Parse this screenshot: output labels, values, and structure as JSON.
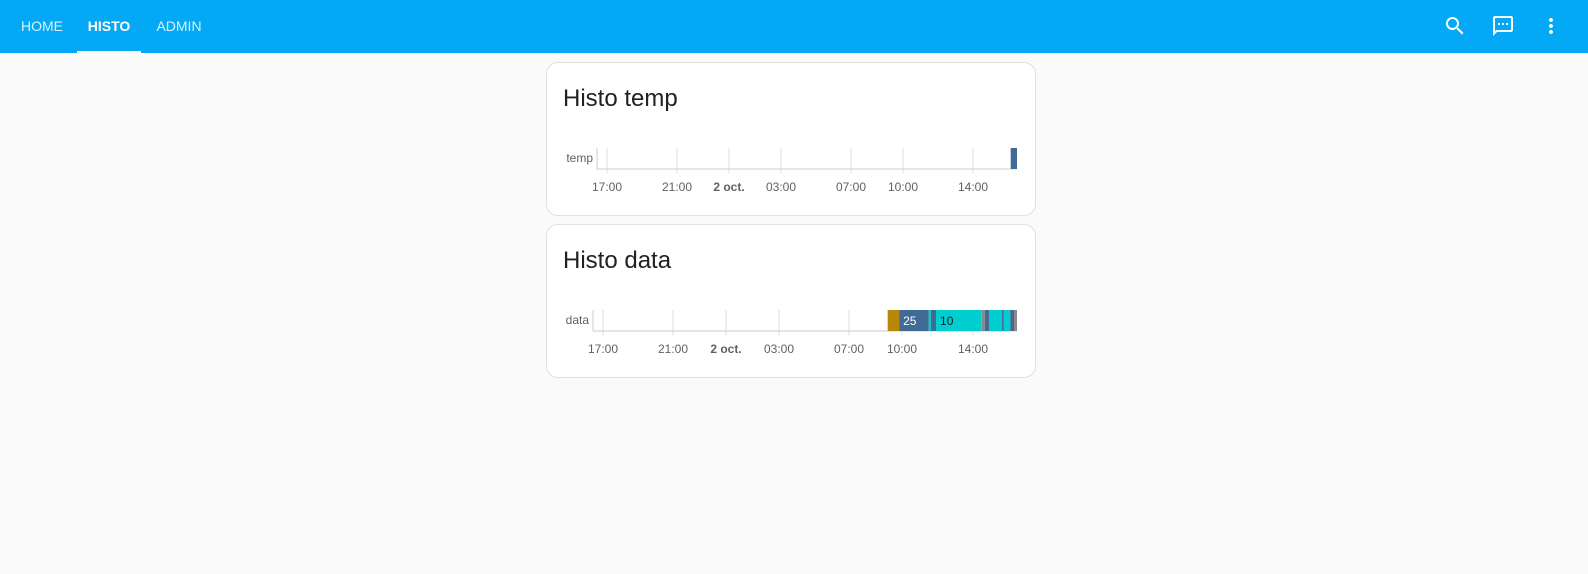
{
  "tabs": [
    {
      "label": "HOME",
      "active": false
    },
    {
      "label": "HISTO",
      "active": true
    },
    {
      "label": "ADMIN",
      "active": false
    }
  ],
  "toolbar_icons": [
    "search-icon",
    "chat-message-icon",
    "more-vertical-icon"
  ],
  "colors": {
    "header": "#03a9f4",
    "background": "#fafafa",
    "temp_bar": "#3f6b95",
    "data_gold": "#b8860b",
    "data_blue": "#3f6b95",
    "data_cyan": "#00cdd0",
    "data_gray": "#888888"
  },
  "cards": [
    {
      "title": "Histo temp",
      "row_label": "temp",
      "ticks": [
        {
          "label": "17:00",
          "bold": false
        },
        {
          "label": "21:00",
          "bold": false
        },
        {
          "label": "2 oct.",
          "bold": true
        },
        {
          "label": "03:00",
          "bold": false
        },
        {
          "label": "07:00",
          "bold": false
        },
        {
          "label": "10:00",
          "bold": false
        },
        {
          "label": "14:00",
          "bold": false
        }
      ],
      "segments": [
        {
          "state": "",
          "color": "temp_bar",
          "start": 0.985,
          "end": 1.0
        }
      ]
    },
    {
      "title": "Histo data",
      "row_label": "data",
      "ticks": [
        {
          "label": "17:00",
          "bold": false
        },
        {
          "label": "21:00",
          "bold": false
        },
        {
          "label": "2 oct.",
          "bold": true
        },
        {
          "label": "03:00",
          "bold": false
        },
        {
          "label": "07:00",
          "bold": false
        },
        {
          "label": "10:00",
          "bold": false
        },
        {
          "label": "14:00",
          "bold": false
        }
      ],
      "segments": [
        {
          "state": "",
          "color": "data_gold",
          "start": 0.695,
          "end": 0.722
        },
        {
          "state": "25",
          "color": "data_blue",
          "start": 0.722,
          "end": 0.792
        },
        {
          "state": "",
          "color": "data_cyan",
          "start": 0.792,
          "end": 0.797
        },
        {
          "state": "",
          "color": "data_blue",
          "start": 0.797,
          "end": 0.809
        },
        {
          "state": "10",
          "color": "data_cyan",
          "start": 0.809,
          "end": 0.917
        },
        {
          "state": "",
          "color": "data_gray",
          "start": 0.917,
          "end": 0.924
        },
        {
          "state": "",
          "color": "data_blue",
          "start": 0.924,
          "end": 0.934
        },
        {
          "state": "",
          "color": "data_cyan",
          "start": 0.934,
          "end": 0.964
        },
        {
          "state": "",
          "color": "data_blue",
          "start": 0.964,
          "end": 0.969
        },
        {
          "state": "",
          "color": "data_cyan",
          "start": 0.969,
          "end": 0.984
        },
        {
          "state": "",
          "color": "data_blue",
          "start": 0.984,
          "end": 0.993
        },
        {
          "state": "",
          "color": "data_gray",
          "start": 0.993,
          "end": 1.0
        }
      ]
    }
  ]
}
